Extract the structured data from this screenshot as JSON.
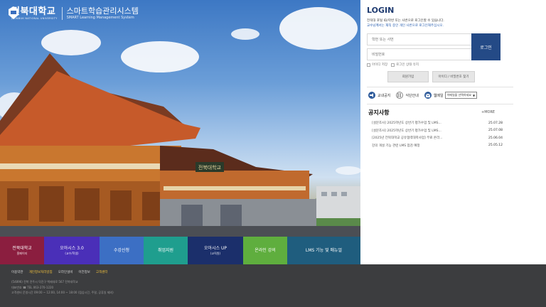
{
  "brand": {
    "univ_name": "전북대학교",
    "univ_en": "JEONBUK NATIONAL UNIVERSITY",
    "system_ko": "스마트학습관리시스템",
    "system_en": "SMART Learning Management System"
  },
  "hero": {
    "sign_text": "전북대학교"
  },
  "quick_menu": [
    {
      "title": "전북대학교",
      "sub": "홈페이지",
      "color": "#8b1e3f"
    },
    {
      "title": "오아시스 3.0",
      "sub": "(교수/학생)",
      "color": "#4a2fb8"
    },
    {
      "title": "수강신청",
      "sub": "",
      "color": "#3c6fc4"
    },
    {
      "title": "취업지원",
      "sub": "",
      "color": "#1f9e8e"
    },
    {
      "title": "오아시스 UP",
      "sub": "(교직원)",
      "color": "#1b2f6b"
    },
    {
      "title": "온라인 강의",
      "sub": "",
      "color": "#5fae3e"
    },
    {
      "title": "LMS 기능 및 매뉴얼",
      "sub": "",
      "color": "#1f5d7e"
    }
  ],
  "login": {
    "title": "LOGIN",
    "desc_line1": "전북대 포털 ID/학번 또는 사번으로 로그인할 수 있습니다.",
    "desc_line2": "교수님께서는 재직 중인 개인 사번으로 로그인해주십시오.",
    "id_placeholder": "학번 또는 사번",
    "pw_placeholder": "비밀번호",
    "login_button": "로그인",
    "save_id": "아이디 저장",
    "keep_login": "로그인 상태 유지",
    "signup_button": "회원가입",
    "find_button": "아이디 / 비밀번호 찾기"
  },
  "links": {
    "notice": "교내공지",
    "meal": "식단안내",
    "webmail": "웹메일",
    "webmail_select": "이메일을 선택하세요"
  },
  "notices": {
    "title": "공지사항",
    "more": "+MORE",
    "items": [
      {
        "text": "[설문조사] 2025학년도 상반기 평가수업 및 LMS...",
        "date": "25.07.28"
      },
      {
        "text": "[설문조사] 2025학년도 상반기 평가수업 및 LMS...",
        "date": "25.07.08"
      },
      {
        "text": "[2025년 전북대학교 공유협력대학사업] 무료 온라...",
        "date": "25.06.04"
      },
      {
        "text": "강의 개설 기능 관련 LMS 점검 예정",
        "date": "25.05.12"
      }
    ]
  },
  "footer": {
    "links": [
      "이용약관",
      "개인정보처리방침",
      "오라인설비",
      "이전정보",
      "고객센터"
    ],
    "address": "(54896) 전북 전주시 덕진구 백제대로 567 전북대학교",
    "phone": "TEL 063-270-1220",
    "hours": "고객센터 운영시간 09:00 ~ 12:00, 14:00 ~ 18:00 (점심시간, 주말, 공휴일 제외)",
    "phone_label": "대표번호"
  }
}
